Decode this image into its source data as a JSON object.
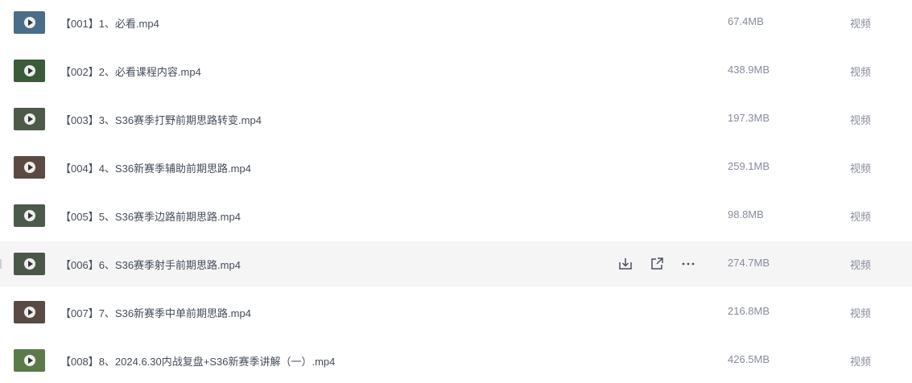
{
  "rows": [
    {
      "name": "【001】1、必看.mp4",
      "size": "67.4MB",
      "type": "视频",
      "thumb_bg": "#4a6d8a",
      "thumb_fg": "#d7d2c9"
    },
    {
      "name": "【002】2、必看课程内容.mp4",
      "size": "438.9MB",
      "type": "视频",
      "thumb_bg": "#3a5a3a",
      "thumb_fg": "#7a9a6a"
    },
    {
      "name": "【003】3、S36赛季打野前期思路转变.mp4",
      "size": "197.3MB",
      "type": "视频",
      "thumb_bg": "#4e5a48",
      "thumb_fg": "#c8c2b4"
    },
    {
      "name": "【004】4、S36新赛季辅助前期思路.mp4",
      "size": "259.1MB",
      "type": "视频",
      "thumb_bg": "#5b4a44",
      "thumb_fg": "#c94b3e"
    },
    {
      "name": "【005】5、S36赛季边路前期思路.mp4",
      "size": "98.8MB",
      "type": "视频",
      "thumb_bg": "#4a5b4a",
      "thumb_fg": "#c8c2b4"
    },
    {
      "name": "【006】6、S36赛季射手前期思路.mp4",
      "size": "274.7MB",
      "type": "视频",
      "thumb_bg": "#4a5848",
      "thumb_fg": "#c8c2b4"
    },
    {
      "name": "【007】7、S36新赛季中单前期思路.mp4",
      "size": "216.8MB",
      "type": "视频",
      "thumb_bg": "#5a4a44",
      "thumb_fg": "#c94b3e"
    },
    {
      "name": "【008】8、2024.6.30内战复盘+S36新赛季讲解（一）.mp4",
      "size": "426.5MB",
      "type": "视频",
      "thumb_bg": "#5a7a4a",
      "thumb_fg": "#a9c08a"
    }
  ],
  "hover_row_index": 5,
  "hover_actions": [
    "download-icon",
    "share-icon",
    "more-icon"
  ],
  "colors": {
    "row_hover_bg": "#f5f5f6",
    "text_primary": "#454d5a",
    "text_secondary": "#878c9c"
  }
}
